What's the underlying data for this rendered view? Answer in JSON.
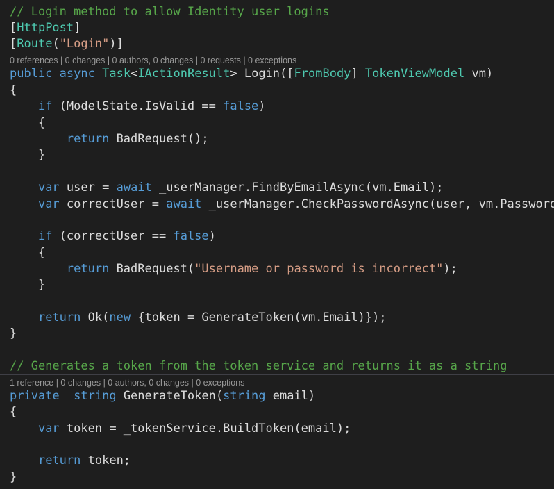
{
  "colors": {
    "background": "#1e1e1e",
    "keyword": "#569cd6",
    "type": "#4ec9b0",
    "string": "#d69d85",
    "comment": "#57a64a",
    "text": "#dcdcdc",
    "codelens": "#999999"
  },
  "login_method": {
    "comment": "// Login method to allow Identity user logins",
    "attr_httppost": "HttpPost",
    "attr_route_name": "Route",
    "attr_route_value": "\"Login\"",
    "codelens": "0 references | 0 changes | 0 authors, 0 changes | 0 requests | 0 exceptions",
    "sig": {
      "public": "public",
      "async": "async",
      "task": "Task",
      "iactionresult": "IActionResult",
      "login": "Login",
      "frombody": "FromBody",
      "tokenviewmodel": "TokenViewModel",
      "vm": "vm"
    },
    "if1": {
      "if": "if",
      "cond": "ModelState.IsValid ==",
      "false": "false"
    },
    "return_badrequest": {
      "return": "return",
      "call": "BadRequest();"
    },
    "var_user": {
      "var": "var",
      "lhs": "user =",
      "await": "await",
      "call": "_userManager.FindByEmailAsync(vm.Email);"
    },
    "var_correct": {
      "var": "var",
      "lhs": "correctUser =",
      "await": "await",
      "call": "_userManager.CheckPasswordAsync(user, vm.Password);"
    },
    "if2": {
      "if": "if",
      "cond": "correctUser ==",
      "false": "false"
    },
    "return_badrequest_msg": {
      "return": "return",
      "call": "BadRequest(",
      "message": "\"Username or password is incorrect\"",
      "close": ");"
    },
    "return_ok": {
      "return": "return",
      "call": "Ok(",
      "new": "new",
      "body": "{token = GenerateToken(vm.Email)});"
    }
  },
  "generate_method": {
    "comment_a": "// Generates a token from the token service ",
    "comment_b": "and returns it as a string",
    "codelens": "1 reference | 0 changes | 0 authors, 0 changes | 0 exceptions",
    "sig": {
      "private": "private",
      "string1": "string",
      "name": "GenerateToken(",
      "string2": "string",
      "param": "email)"
    },
    "var_token": {
      "var": "var",
      "rest": "token = _tokenService.BuildToken(email);"
    },
    "return_token": {
      "return": "return",
      "rest": "token;"
    }
  }
}
